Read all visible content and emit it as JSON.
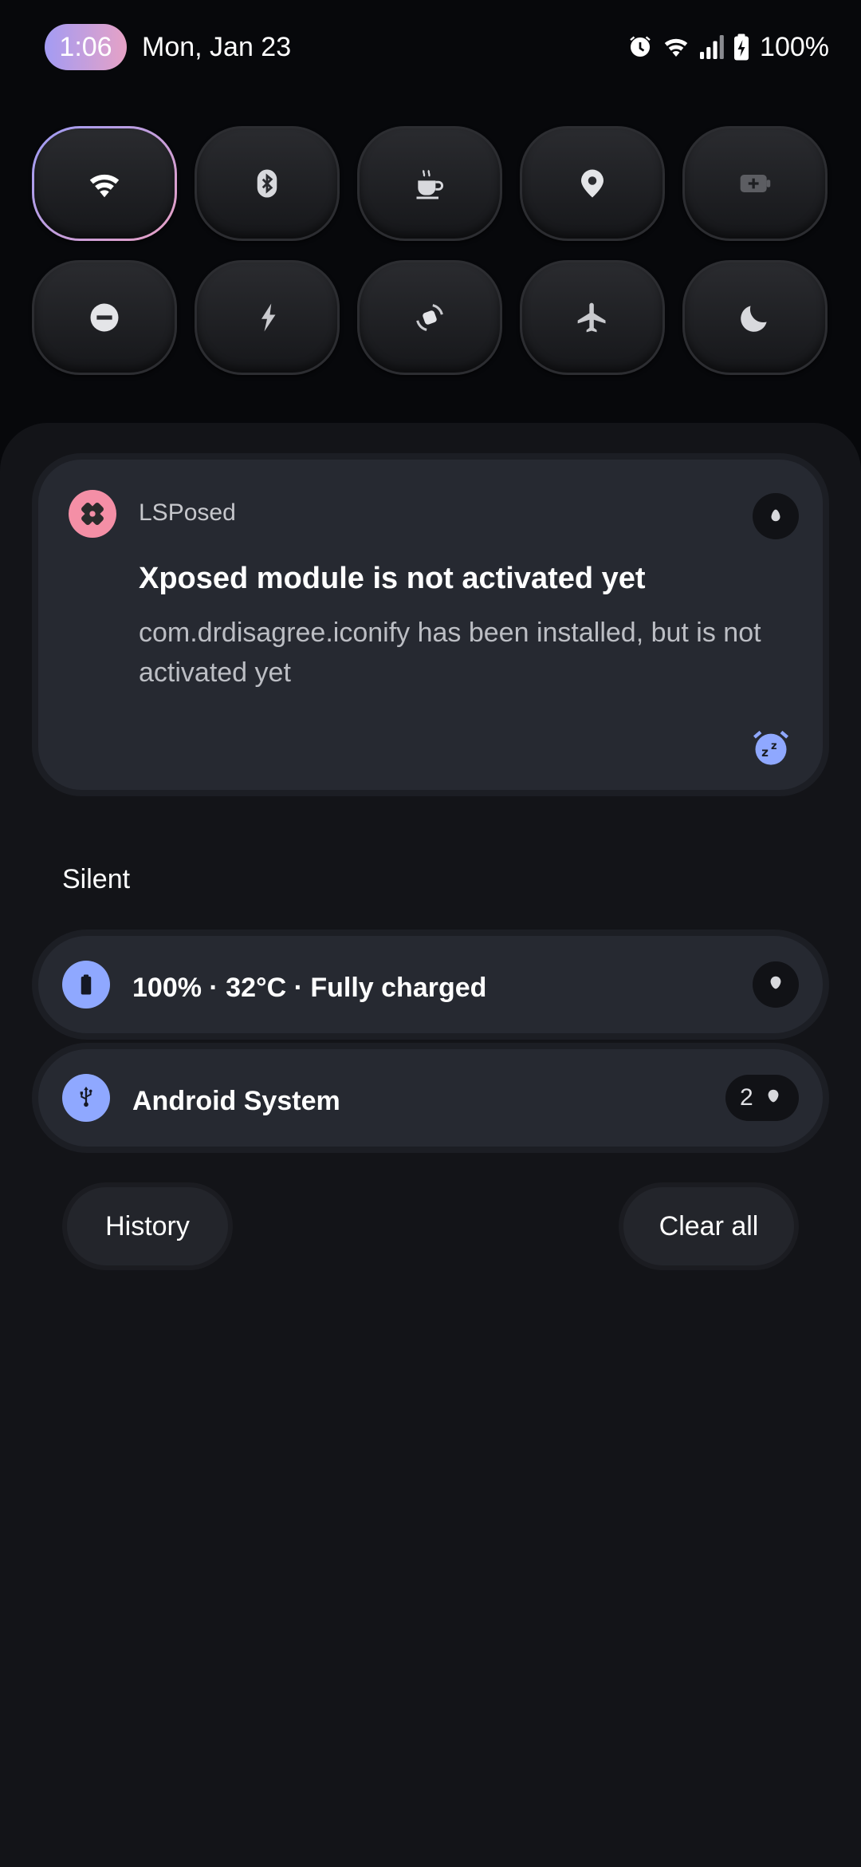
{
  "status_bar": {
    "time": "1:06",
    "date": "Mon, Jan 23",
    "battery_percent": "100%",
    "icons": [
      "alarm-icon",
      "wifi-icon",
      "signal-icon",
      "battery-charging-icon"
    ]
  },
  "quick_tiles": [
    {
      "name": "wifi",
      "icon": "wifi-icon",
      "active": true
    },
    {
      "name": "bluetooth",
      "icon": "bluetooth-icon",
      "active": false
    },
    {
      "name": "caffeine",
      "icon": "coffee-icon",
      "active": false
    },
    {
      "name": "location",
      "icon": "location-icon",
      "active": false
    },
    {
      "name": "battery-saver",
      "icon": "battery-plus-icon",
      "active": false
    },
    {
      "name": "do-not-disturb",
      "icon": "dnd-icon",
      "active": false
    },
    {
      "name": "flashlight",
      "icon": "flashlight-icon",
      "active": false
    },
    {
      "name": "auto-rotate",
      "icon": "rotate-icon",
      "active": false
    },
    {
      "name": "airplane-mode",
      "icon": "airplane-icon",
      "active": false
    },
    {
      "name": "dark-theme",
      "icon": "moon-icon",
      "active": false
    }
  ],
  "notification": {
    "app_name": "LSPosed",
    "title": "Xposed module is not activated yet",
    "text": "com.drdisagree.iconify has been installed, but is not activated yet"
  },
  "silent_section": {
    "label": "Silent",
    "items": [
      {
        "title": "100% · 32°C · Fully charged",
        "icon": "battery-icon"
      },
      {
        "title": "Android System",
        "icon": "usb-icon",
        "count": "2"
      }
    ]
  },
  "actions": {
    "history_label": "History",
    "clear_all_label": "Clear all"
  },
  "colors": {
    "accent_gradient_start": "#a39bf3",
    "accent_gradient_end": "#e6a2c6",
    "row_icon_bg": "#8fa8ff",
    "lsposed_icon_bg": "#f48fa6"
  }
}
